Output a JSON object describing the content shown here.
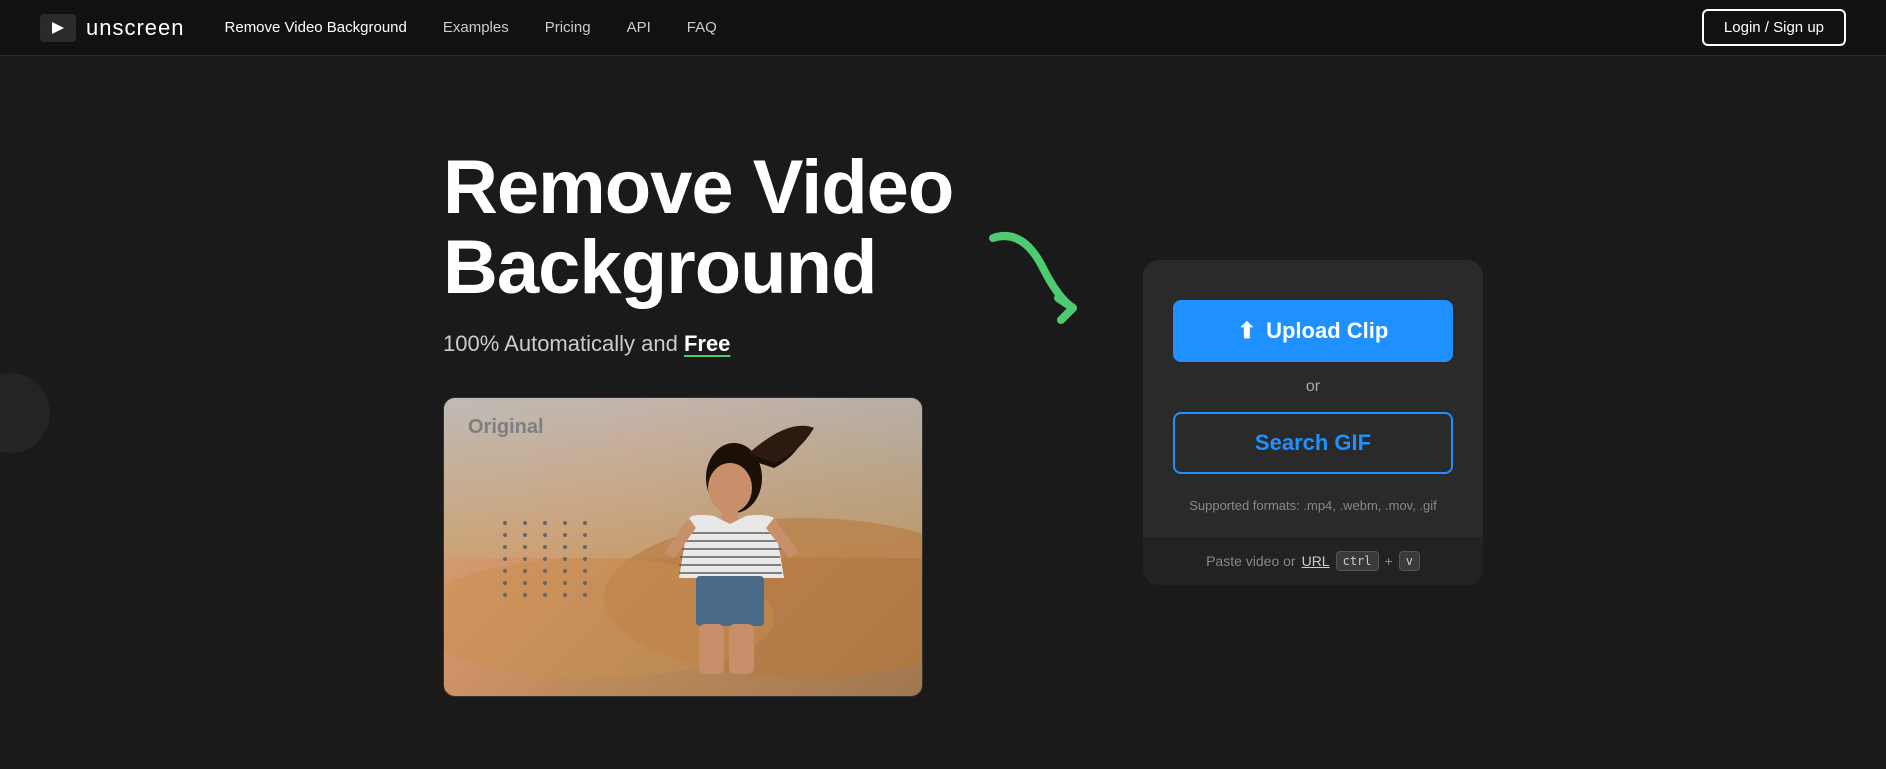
{
  "nav": {
    "logo_text": "unscreen",
    "links": [
      {
        "label": "Remove Video Background",
        "active": true
      },
      {
        "label": "Examples",
        "active": false
      },
      {
        "label": "Pricing",
        "active": false
      },
      {
        "label": "API",
        "active": false
      },
      {
        "label": "FAQ",
        "active": false
      }
    ],
    "login_label": "Login / Sign up"
  },
  "hero": {
    "title_line1": "Remove Video",
    "title_line2": "Background",
    "subtitle_prefix": "100% Automatically and ",
    "subtitle_free": "Free",
    "video_label": "Original",
    "supported_formats": "Supported formats: .mp4, .webm, .mov, .gif",
    "paste_text": "Paste video or ",
    "paste_url_text": "URL",
    "ctrl_key": "ctrl",
    "v_key": "v"
  },
  "upload_card": {
    "upload_label": "Upload Clip",
    "or_label": "or",
    "search_gif_label": "Search GIF"
  }
}
